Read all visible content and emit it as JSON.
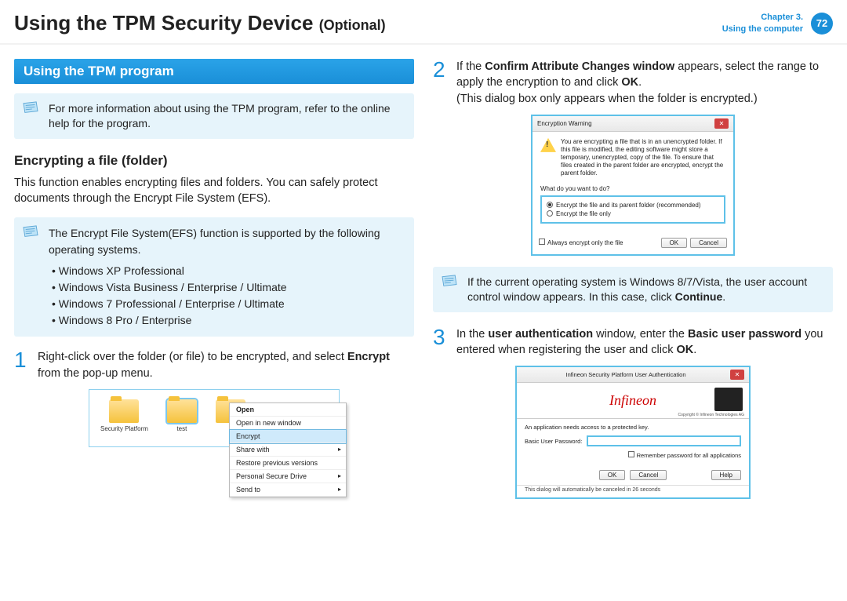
{
  "header": {
    "title_main": "Using the TPM Security Device",
    "title_opt": "(Optional)",
    "chapter_line1": "Chapter 3.",
    "chapter_line2": "Using the computer",
    "page_num": "72"
  },
  "left": {
    "banner": "Using the TPM program",
    "note1": "For more information about using the TPM program, refer to the online help for the program.",
    "h3": "Encrypting a file (folder)",
    "body": "This function enables encrypting files and folders. You can safely protect documents through the Encrypt File System (EFS).",
    "note2_intro": "The Encrypt File System(EFS) function is supported by the following operating systems.",
    "os_list": [
      "Windows XP Professional",
      "Windows Vista Business / Enterprise / Ultimate",
      "Windows 7 Professional / Enterprise / Ultimate",
      "Windows 8 Pro / Enterprise"
    ],
    "step1_num": "1",
    "step1_pre": "Right-click over the folder (or file) to be encrypted, and select ",
    "step1_bold": "Encrypt",
    "step1_post": " from the pop-up menu.",
    "ctx": {
      "folder1": "Security Platform",
      "folder2": "test",
      "items": [
        "Open",
        "Open in new window",
        "Encrypt",
        "Share with",
        "Restore previous versions",
        "Personal Secure Drive",
        "Send to"
      ]
    }
  },
  "right": {
    "step2_num": "2",
    "step2_a": "If the ",
    "step2_b": "Confirm Attribute Changes window",
    "step2_c": " appears, select the range to apply the encryption to and click ",
    "step2_d": "OK",
    "step2_e": ".",
    "step2_f": "(This dialog box only appears when the folder is encrypted.)",
    "dlg": {
      "title": "Encryption Warning",
      "warn": "You are encrypting a file that is in an unencrypted folder. If this file is modified, the editing software might store a temporary, unencrypted, copy of the file. To ensure that files created in the parent folder are encrypted, encrypt the parent folder.",
      "prompt": "What do you want to do?",
      "opt1": "Encrypt the file and its parent folder (recommended)",
      "opt2": "Encrypt the file only",
      "always": "Always encrypt only the file",
      "ok": "OK",
      "cancel": "Cancel"
    },
    "note3_a": "If the current operating system is Windows 8/7/Vista, the user account control window appears. In this case, click ",
    "note3_b": "Continue",
    "note3_c": ".",
    "step3_num": "3",
    "step3_a": "In the ",
    "step3_b": "user authentication",
    "step3_c": " window, enter the ",
    "step3_d": "Basic user password",
    "step3_e": " you entered when registering the user and click ",
    "step3_f": "OK",
    "step3_g": ".",
    "inf": {
      "title": "Infineon Security Platform User Authentication",
      "logo": "Infineon",
      "copyright": "Copyright © Infineon Technologies AG",
      "line1": "An application needs access to a protected key.",
      "label": "Basic User Password:",
      "remember": "Remember password for all applications",
      "ok": "OK",
      "cancel": "Cancel",
      "help": "Help",
      "footer": "This dialog will automatically be canceled in 26 seconds"
    }
  }
}
